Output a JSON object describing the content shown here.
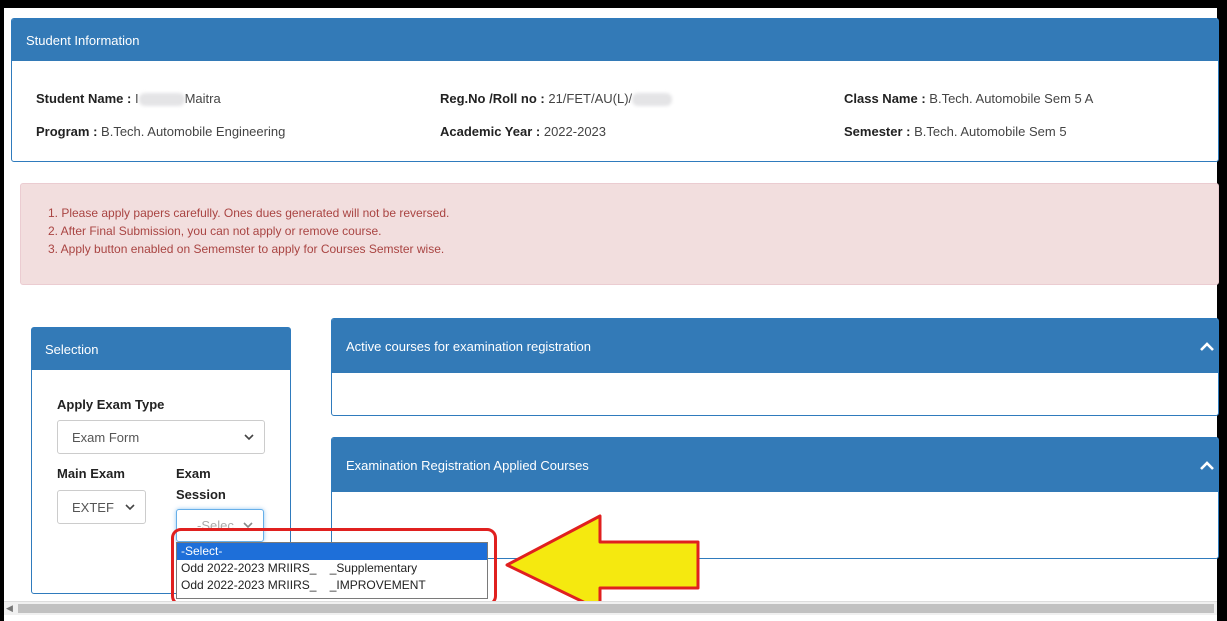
{
  "student": {
    "header": "Student Information",
    "name_label": "Student Name :",
    "name_visible": "Maitra",
    "name_prefix": "I",
    "reg_label": "Reg.No /Roll no :",
    "reg_value": "21/FET/AU(L)/",
    "class_label": "Class Name :",
    "class_value": "B.Tech. Automobile Sem 5 A",
    "program_label": "Program :",
    "program_value": "B.Tech. Automobile Engineering",
    "year_label": "Academic Year :",
    "year_value": "2022-2023",
    "semester_label": "Semester :",
    "semester_value": "B.Tech. Automobile Sem 5"
  },
  "notice": {
    "items": [
      "1. Please apply papers carefully. Ones dues generated will not be reversed.",
      "2. After Final Submission, you can not apply or remove course.",
      "3. Apply button enabled on Sememster to apply for Courses Semster wise."
    ]
  },
  "selection": {
    "header": "Selection",
    "apply_exam_type_label": "Apply Exam Type",
    "apply_exam_type_value": "Exam Form",
    "main_exam_label": "Main Exam",
    "main_exam_value": "EXTEF",
    "exam_session_label_1": "Exam",
    "exam_session_label_2": "Session",
    "exam_session_value": "-Selec"
  },
  "dropdown": {
    "options": [
      "-Select-",
      "Odd 2022-2023 MRIIRS_    _Supplementary",
      "Odd 2022-2023 MRIIRS_    _IMPROVEMENT"
    ],
    "selected_index": 0
  },
  "panels": {
    "active_courses": "Active courses for examination registration",
    "applied_courses": "Examination Registration Applied Courses"
  },
  "colors": {
    "primary": "#337ab7",
    "alert_bg": "#f2dede",
    "alert_text": "#a94442",
    "highlight": "#e0201f",
    "arrow": "#f5e90f"
  },
  "icons": [
    "chevron-down-icon",
    "chevron-up-icon",
    "scroll-left-icon",
    "pointer-arrow-icon"
  ]
}
